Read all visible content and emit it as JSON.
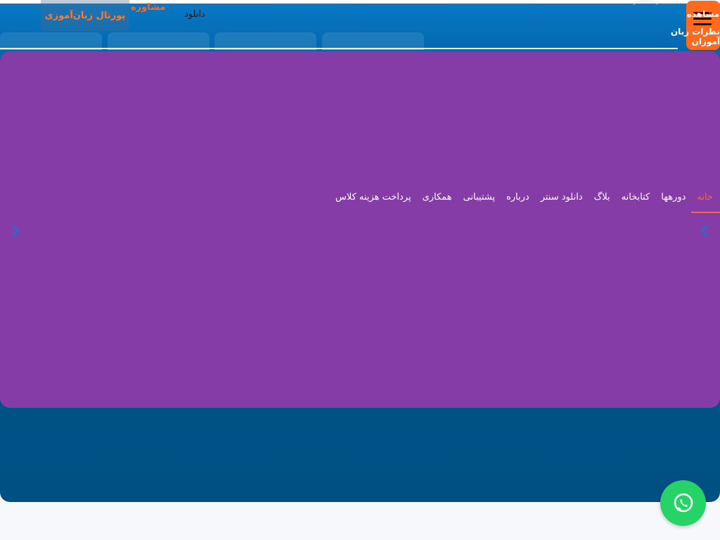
{
  "header": {
    "download_label": "دانلود",
    "consult_label": "مشاوره",
    "portal_label": "پورتال زبان‌آموزی",
    "view_label": "مشاهده",
    "reviews_label": "نظرات زبان آموزان"
  },
  "menu": {
    "items": [
      {
        "label": "خانه",
        "active": true
      },
      {
        "label": "دورهها"
      },
      {
        "label": "کتابخانه"
      },
      {
        "label": "بلاگ"
      },
      {
        "label": "دانلود سنتر"
      },
      {
        "label": "درباره"
      },
      {
        "label": "پشتیبانی"
      },
      {
        "label": "همکاری"
      },
      {
        "label": "پرداخت هزینه کلاس"
      }
    ]
  },
  "icons": {
    "menu": "hamburger-icon",
    "prev": "chevron-left-icon",
    "next": "chevron-left-icon",
    "whatsapp": "whatsapp-icon"
  },
  "colors": {
    "accent": "#ff6a1f",
    "overlay": "#853ca6",
    "hero_blue": "#005386",
    "whatsapp": "#25d366"
  }
}
